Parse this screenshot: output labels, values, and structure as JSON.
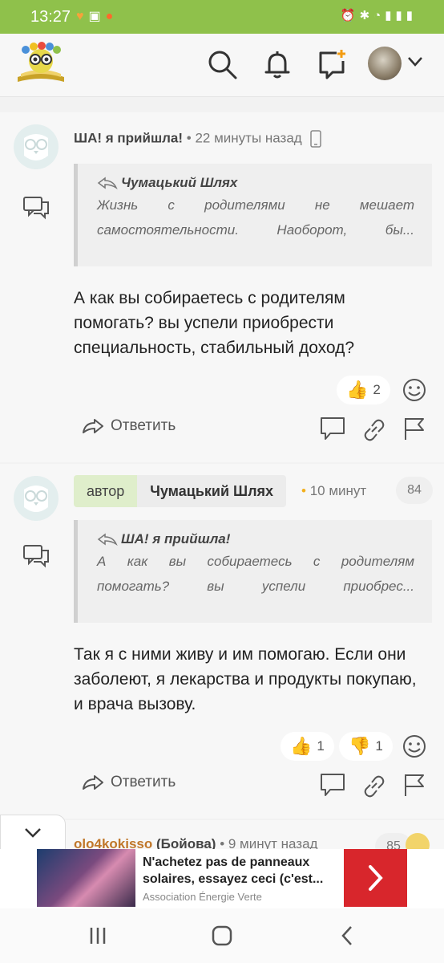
{
  "status": {
    "time": "13:27",
    "icons": [
      "heart-icon",
      "image-icon",
      "app-icon"
    ],
    "right_icons": [
      "alarm-icon",
      "bluetooth-icon",
      "wifi-icon",
      "signal-icon",
      "battery-icon"
    ]
  },
  "header": {
    "logo": "site-logo",
    "icons": [
      "search-icon",
      "bell-icon",
      "new-post-icon"
    ]
  },
  "comments": [
    {
      "author": "ША! я прийшла!",
      "time": "22 минуты назад",
      "quote_author": "Чумацький Шлях",
      "quote_line1": "Жизнь с родителями не мешает",
      "quote_line2": "самостоятельности. Наоборот, бы...",
      "text": "А как вы собираетесь с родителям помогать? вы успели приобрести специальность, стабильный доход?",
      "likes": "2",
      "reply_label": "Ответить"
    },
    {
      "author_badge": "автор",
      "author": "Чумацький Шлях",
      "time": "10 минут",
      "count": "84",
      "quote_author": "ША! я прийшла!",
      "quote_line1": "А как вы собираетесь с родителям",
      "quote_line2": "помогать? вы успели приобрес...",
      "text": "Так я с ними живу и им помогаю. Если они заболеют, я лекарства и продукты покупаю, и врача вызову.",
      "likes": "1",
      "dislikes": "1",
      "reply_label": "Ответить"
    },
    {
      "author": "olo4kokisso",
      "author_suffix": "(Бойова)",
      "time": "9 минут назад",
      "count": "85"
    }
  ],
  "ad": {
    "title_line1": "N'achetez pas de panneaux",
    "title_line2": "solaires, essayez ceci (c'est...",
    "source": "Association Énergie Verte"
  },
  "colors": {
    "accent": "#8fc14b",
    "ad_button": "#d8262c"
  }
}
